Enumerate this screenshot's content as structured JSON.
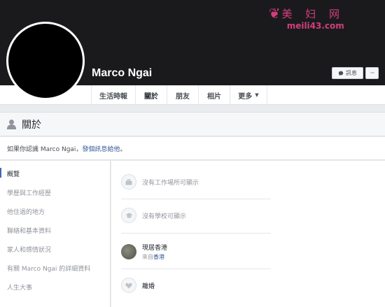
{
  "watermark": {
    "title": "美 妇 网",
    "url": "meili43.com"
  },
  "profile": {
    "name": "Marco Ngai"
  },
  "actions": {
    "message_label": "訊息",
    "more_label": "···"
  },
  "tabs": [
    {
      "label": "生活時報"
    },
    {
      "label": "關於"
    },
    {
      "label": "朋友"
    },
    {
      "label": "相片"
    },
    {
      "label": "更多"
    }
  ],
  "about": {
    "title": "關於",
    "notice_prefix": "如果你認識 Marco Ngai，",
    "notice_link": "發個訊息給他",
    "notice_suffix": "。"
  },
  "sidebar": {
    "items": [
      {
        "label": "概覽"
      },
      {
        "label": "學歷與工作經歷"
      },
      {
        "label": "他住過的地方"
      },
      {
        "label": "聯絡和基本資料"
      },
      {
        "label": "家人和感情狀況"
      },
      {
        "label": "有關 Marco Ngai 的詳細資料"
      },
      {
        "label": "人生大事"
      }
    ]
  },
  "overview": {
    "work": "沒有工作場所可顯示",
    "school": "沒有學校可顯示",
    "current_city": "現居香港",
    "from_prefix": "來自",
    "from_city": "香港",
    "relationship": "離婚"
  },
  "colors": {
    "accent": "#4267b2",
    "link": "#365899",
    "watermark": "#d23e7c"
  },
  "icons": [
    "person-icon",
    "briefcase-icon",
    "graduation-cap-icon",
    "heart-icon",
    "chat-bubble-icon",
    "caret-down-icon",
    "lotus-icon"
  ]
}
